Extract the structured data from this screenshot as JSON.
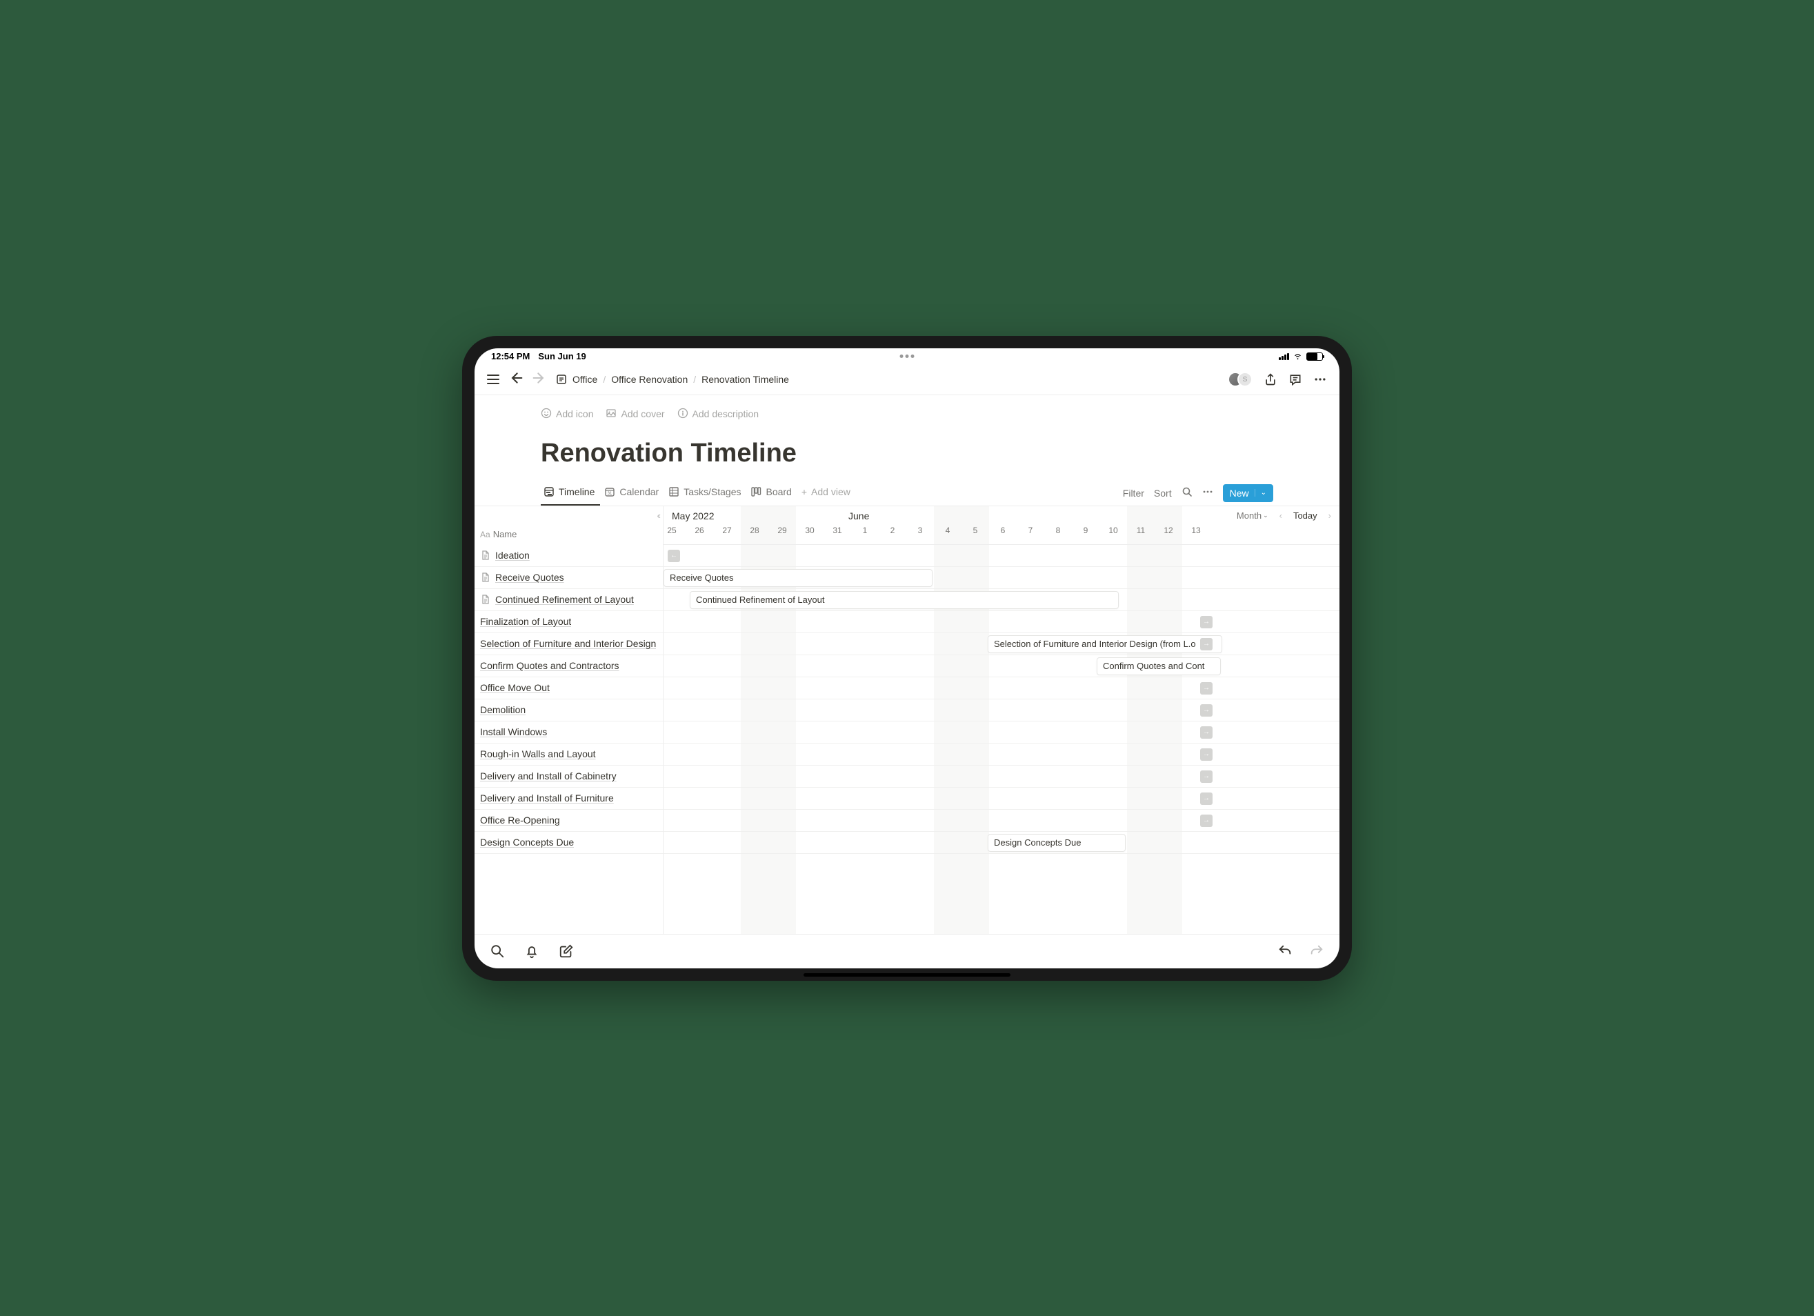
{
  "status": {
    "time": "12:54 PM",
    "date": "Sun Jun 19"
  },
  "breadcrumb": {
    "root": "Office",
    "parent": "Office Renovation",
    "current": "Renovation Timeline"
  },
  "page_actions": {
    "add_icon": "Add icon",
    "add_cover": "Add cover",
    "add_description": "Add description"
  },
  "page_title": "Renovation Timeline",
  "views": {
    "tabs": [
      {
        "label": "Timeline"
      },
      {
        "label": "Calendar"
      },
      {
        "label": "Tasks/Stages"
      },
      {
        "label": "Board"
      }
    ],
    "add_view": "Add view",
    "filter": "Filter",
    "sort": "Sort",
    "new": "New"
  },
  "timeline": {
    "month_a": "May 2022",
    "month_b": "June",
    "scale": "Month",
    "today": "Today",
    "name_header": "Name",
    "dates": [
      "25",
      "26",
      "27",
      "28",
      "29",
      "30",
      "31",
      "1",
      "2",
      "3",
      "4",
      "5",
      "6",
      "7",
      "8",
      "9",
      "10",
      "11",
      "12",
      "13"
    ],
    "rows": [
      {
        "label": "Ideation",
        "has_icon": true
      },
      {
        "label": "Receive Quotes",
        "has_icon": true
      },
      {
        "label": "Continued Refinement of Layout",
        "has_icon": true
      },
      {
        "label": "Finalization of Layout",
        "has_icon": false
      },
      {
        "label": "Selection of Furniture and Interior Design",
        "has_icon": false
      },
      {
        "label": "Confirm Quotes and Contractors",
        "has_icon": false
      },
      {
        "label": "Office Move Out",
        "has_icon": false
      },
      {
        "label": "Demolition",
        "has_icon": false
      },
      {
        "label": "Install Windows",
        "has_icon": false
      },
      {
        "label": "Rough-in Walls and Layout",
        "has_icon": false
      },
      {
        "label": "Delivery and Install of Cabinetry",
        "has_icon": false
      },
      {
        "label": "Delivery and Install of Furniture",
        "has_icon": false
      },
      {
        "label": "Office Re-Opening",
        "has_icon": false
      },
      {
        "label": "Design Concepts Due",
        "has_icon": false
      }
    ],
    "bars": {
      "receive_quotes": "Receive Quotes",
      "refinement": "Continued Refinement of Layout",
      "selection": "Selection of Furniture and Interior Design (from L.o",
      "confirm": "Confirm Quotes and Cont",
      "design_due": "Design Concepts Due"
    }
  }
}
